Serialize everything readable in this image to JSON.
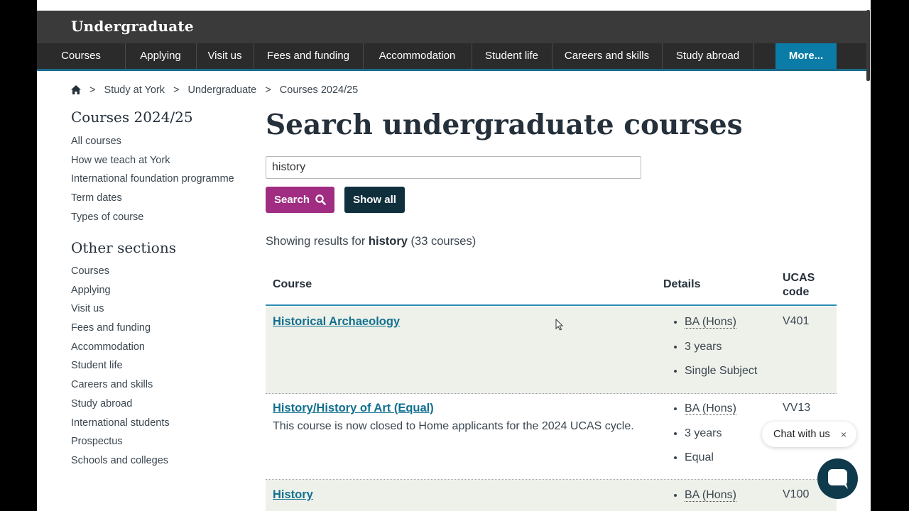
{
  "header": {
    "brand": "Undergraduate"
  },
  "nav": {
    "items": [
      "Courses",
      "Applying",
      "Visit us",
      "Fees and funding",
      "Accommodation",
      "Student life",
      "Careers and skills",
      "Study abroad"
    ],
    "more_label": "More..."
  },
  "breadcrumb": {
    "items": [
      "Study at York",
      "Undergraduate",
      "Courses 2024/25"
    ],
    "separator": ">"
  },
  "sidebar": {
    "section1_title": "Courses 2024/25",
    "section1_items": [
      "All courses",
      "How we teach at York",
      "International foundation programme",
      "Term dates",
      "Types of course"
    ],
    "section2_title": "Other sections",
    "section2_items": [
      "Courses",
      "Applying",
      "Visit us",
      "Fees and funding",
      "Accommodation",
      "Student life",
      "Careers and skills",
      "Study abroad",
      "International students",
      "Prospectus",
      "Schools and colleges"
    ]
  },
  "main": {
    "title": "Search undergraduate courses",
    "search_value": "history",
    "search_button": "Search",
    "show_all_button": "Show all",
    "results_prefix": "Showing results for",
    "results_query": "history",
    "results_count": "(33 courses)"
  },
  "table": {
    "headers": {
      "course": "Course",
      "details": "Details",
      "ucas_line1": "UCAS",
      "ucas_line2": "code"
    },
    "rows": [
      {
        "title": "Historical Archaeology",
        "note": "",
        "details": [
          "BA (Hons)",
          "3 years",
          "Single Subject"
        ],
        "ucas": "V401"
      },
      {
        "title": "History/History of Art (Equal)",
        "note": "This course is now closed to Home applicants for the 2024 UCAS cycle.",
        "details": [
          "BA (Hons)",
          "3 years",
          "Equal"
        ],
        "ucas": "VV13"
      },
      {
        "title": "History",
        "note": "",
        "details": [
          "BA (Hons)"
        ],
        "ucas": "V100"
      }
    ]
  },
  "chat": {
    "label": "Chat with us",
    "close": "×"
  },
  "colors": {
    "search_button": "#a02d82",
    "show_all_button": "#0f2f3d",
    "nav_more": "#0b7ca7",
    "link": "#12708f",
    "row_highlight": "#eef1ea"
  }
}
